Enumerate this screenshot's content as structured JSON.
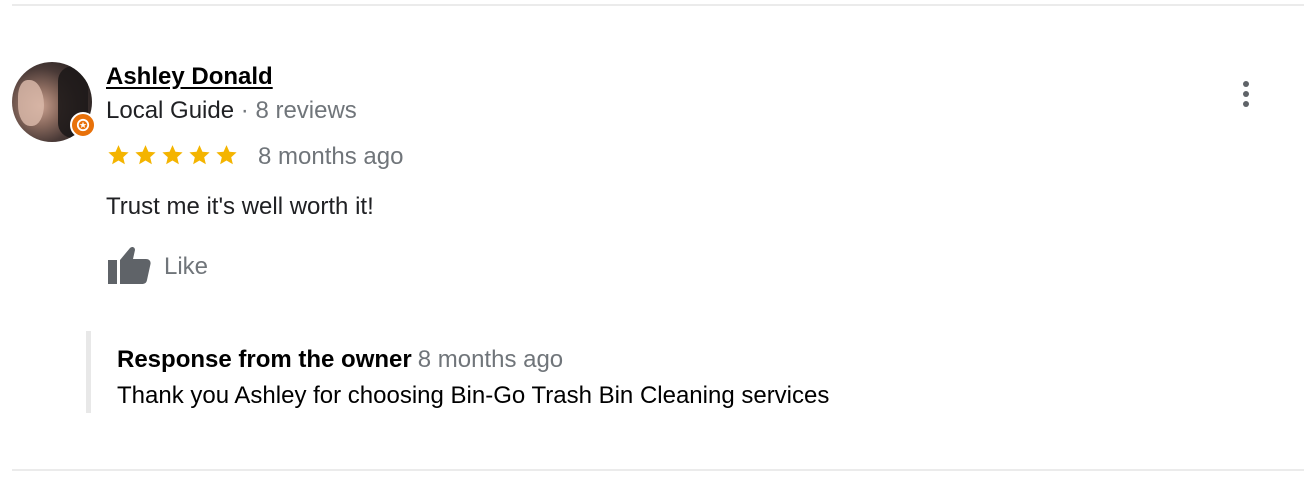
{
  "review": {
    "author": {
      "name": "Ashley Donald",
      "level": "Local Guide",
      "separator": "·",
      "review_count": "8 reviews",
      "badge_color": "#e8710a"
    },
    "rating": {
      "stars": 5,
      "max_stars": 5,
      "star_color": "#f4b400"
    },
    "time_ago": "8 months ago",
    "text": "Trust me it's well worth it!",
    "like_label": "Like",
    "menu_icon": "more-vert-icon"
  },
  "owner_response": {
    "title": "Response from the owner",
    "time_ago": "8 months ago",
    "text": "Thank you Ashley for choosing Bin-Go Trash Bin Cleaning services"
  }
}
